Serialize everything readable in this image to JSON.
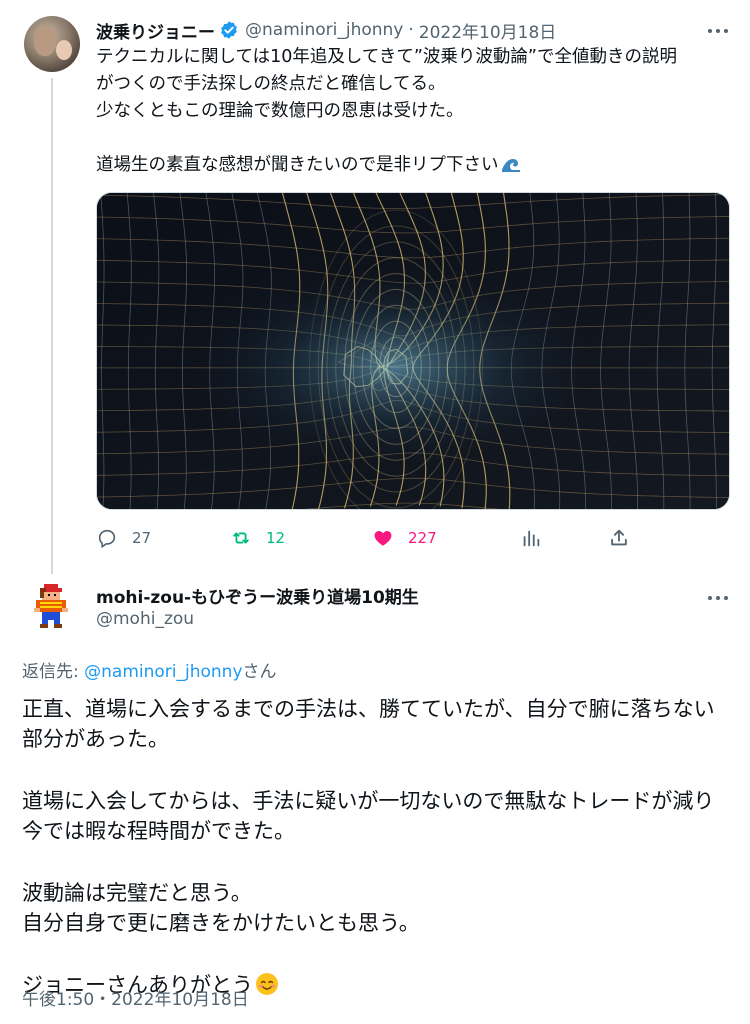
{
  "parent": {
    "name": "波乗りジョニー",
    "handle": "@naminori_jhonny",
    "separator": "·",
    "date": "2022年10月18日",
    "lines": [
      "テクニカルに関しては10年追及してきて”波乗り波動論”で全値動きの説明",
      "がつくので手法探しの終点だと確信してる。",
      "少なくともこの理論で数億円の恩恵は受けた。",
      "道場生の素直な感想が聞きたいので是非リプ下さい"
    ],
    "emoji": "wave-emoji",
    "image_icon": "wavy-grid-artwork",
    "stats": {
      "replies": "27",
      "retweets": "12",
      "likes": "227"
    }
  },
  "reply": {
    "name": "mohi-zou-もひぞうー波乗り道場10期生",
    "handle": "@mohi_zou",
    "replying_to_prefix": "返信先: ",
    "replying_to_mention": "@naminori_jhonny",
    "replying_to_suffix": "さん",
    "lines": [
      "正直、道場に入会するまでの手法は、勝てていたが、自分で腑に落ちない",
      "部分があった。",
      "道場に入会してからは、手法に疑いが一切ないので無駄なトレードが減り",
      "今では暇な程時間ができた。",
      "波動論は完璧だと思う。",
      "自分自身で更に磨きをかけたいとも思う。",
      "ジョニーさんありがとう"
    ],
    "emoji": "smiling-face-emoji",
    "timestamp": "午後1:50・2022年10月18日"
  },
  "colors": {
    "text": "#0f1419",
    "secondary": "#536471",
    "link": "#1d9bf0",
    "retweet": "#00ba7c",
    "like": "#f91880",
    "verified": "#1d9bf0"
  }
}
